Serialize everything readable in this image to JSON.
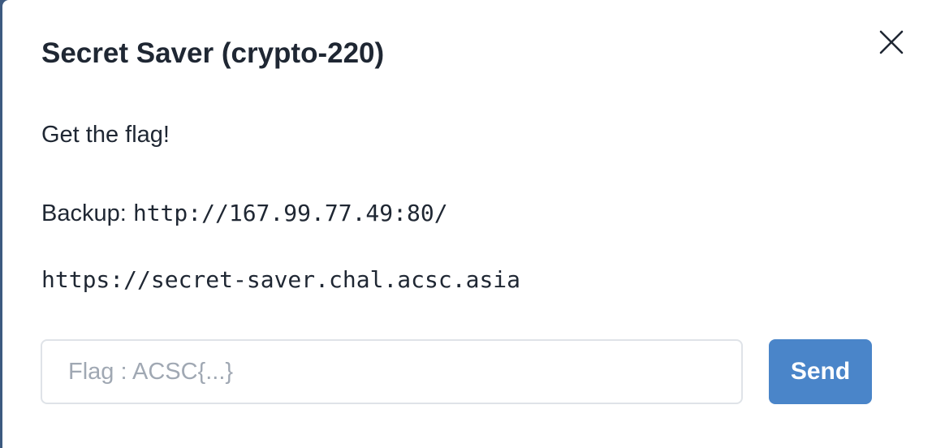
{
  "modal": {
    "title": "Secret Saver (crypto-220)",
    "close_icon": "close-icon",
    "description": "Get the flag!",
    "backup_label": "Backup: ",
    "backup_url": "http://167.99.77.49:80/",
    "challenge_url": "https://secret-saver.chal.acsc.asia",
    "flag_input": {
      "value": "",
      "placeholder": "Flag : ACSC{...}"
    },
    "send_label": "Send"
  },
  "colors": {
    "accent": "#4a85c9",
    "text": "#1f2733",
    "placeholder": "#a0a8b3",
    "input_border": "#dfe3e8"
  }
}
